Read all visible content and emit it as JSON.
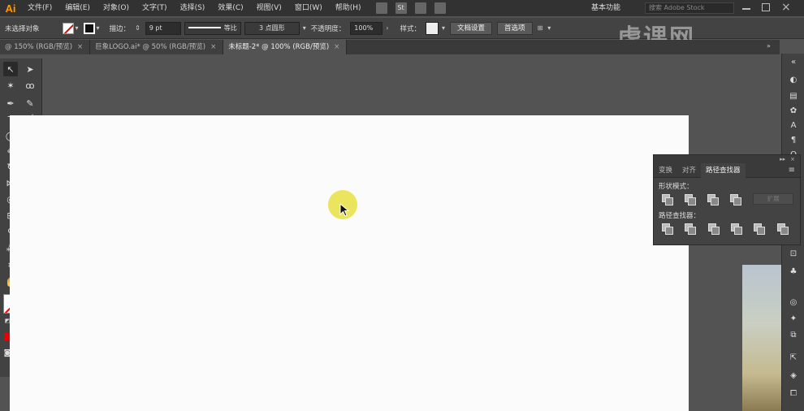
{
  "menubar": {
    "logo": "Ai",
    "items": [
      "文件(F)",
      "编辑(E)",
      "对象(O)",
      "文字(T)",
      "选择(S)",
      "效果(C)",
      "视图(V)",
      "窗口(W)",
      "帮助(H)"
    ],
    "st_icon": "St",
    "workspace": "基本功能",
    "search_placeholder": "搜索 Adobe Stock"
  },
  "watermark": "虎课网",
  "controlbar": {
    "selection_status": "未选择对象",
    "stroke_label": "描边：",
    "stroke_weight": "9 pt",
    "profile_label": "等比",
    "brush_label": "3 点圆形",
    "opacity_label": "不透明度：",
    "opacity_value": "100%",
    "style_label": "样式：",
    "doc_setup_button": "文档设置",
    "preferences_button": "首选项"
  },
  "tabs": [
    {
      "label": "@ 150% (RGB/预览)",
      "active": false
    },
    {
      "label": "巨象LOGO.ai* @ 50% (RGB/预览)",
      "active": false
    },
    {
      "label": "未标题-2* @ 100% (RGB/预览)",
      "active": true
    }
  ],
  "pathfinder": {
    "tabs": [
      "变换",
      "对齐",
      "路径查找器"
    ],
    "active_tab": "路径查找器",
    "shape_modes_label": "形状模式：",
    "pathfinders_label": "路径查找器：",
    "expand_button": "扩展"
  },
  "colors": {
    "accent_logo": "#ff9a00",
    "artboard": "#fbfbfb",
    "cursor_highlight": "#e6dc28"
  }
}
